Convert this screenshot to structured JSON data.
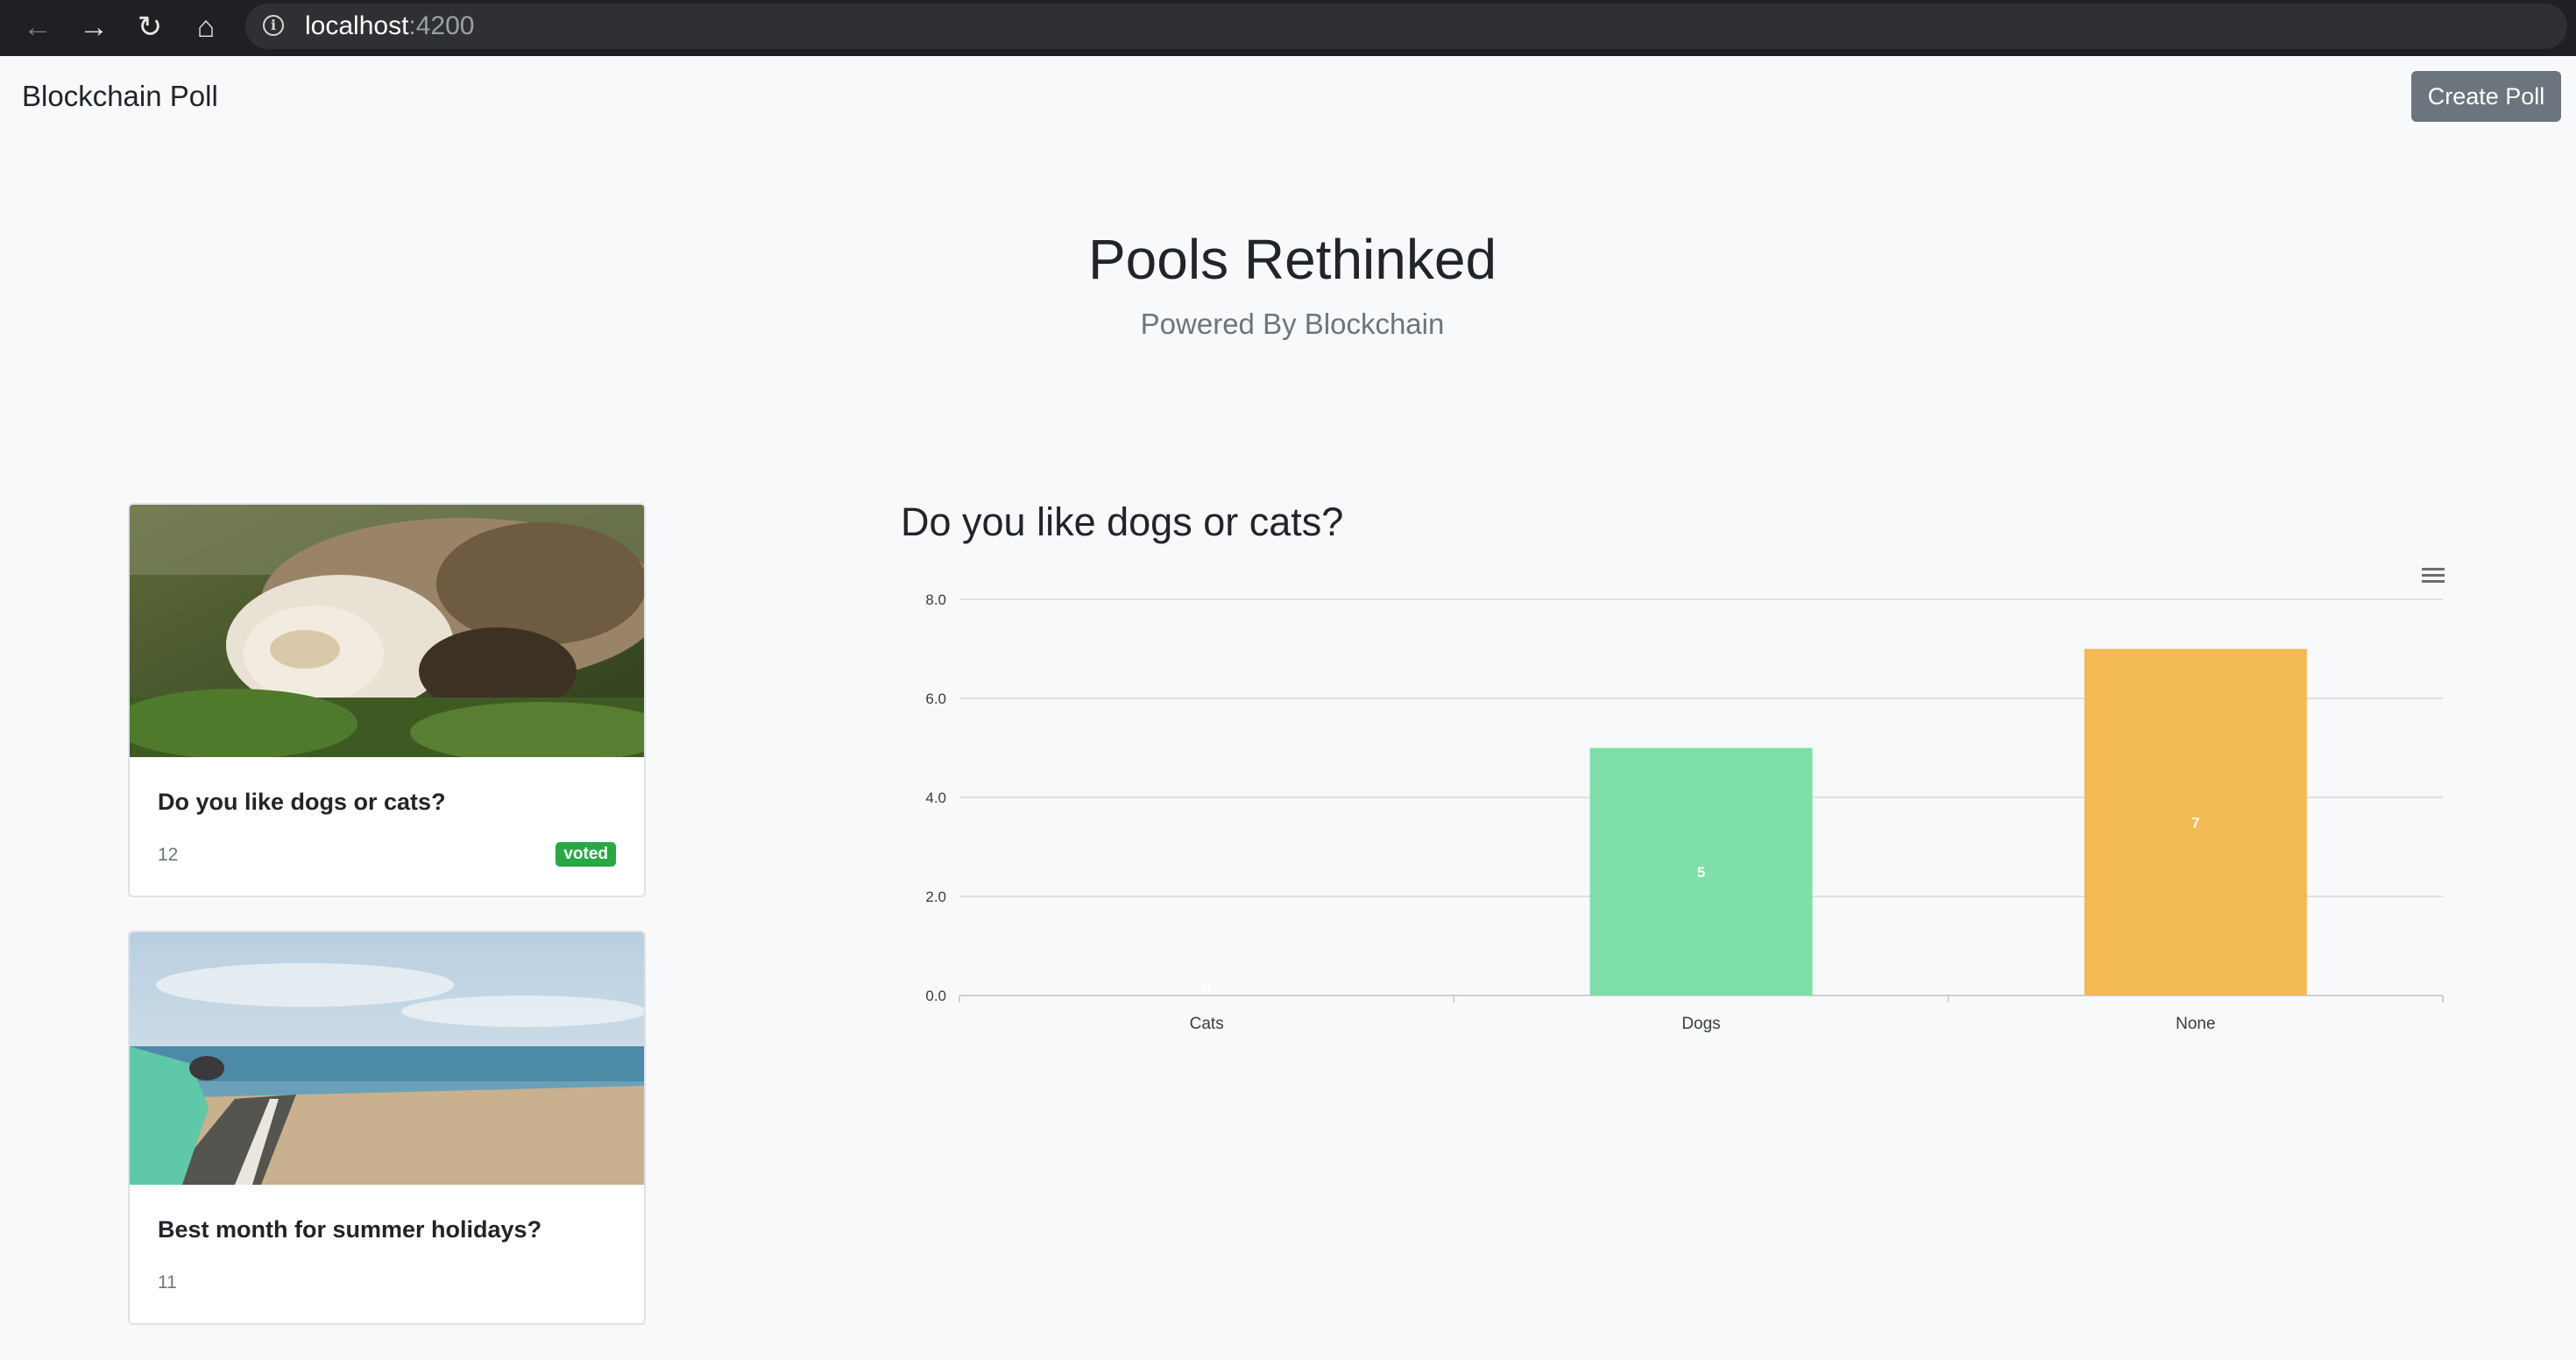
{
  "browser": {
    "url_host": "localhost",
    "url_port": ":4200"
  },
  "navbar": {
    "brand": "Blockchain Poll",
    "create_button": "Create Poll"
  },
  "hero": {
    "title": "Pools Rethinked",
    "subtitle": "Powered By Blockchain"
  },
  "polls": [
    {
      "title": "Do you like dogs or cats?",
      "count": "12",
      "badge": "voted"
    },
    {
      "title": "Best month for summer holidays?",
      "count": "11"
    }
  ],
  "chart_title": "Do you like dogs or cats?",
  "colors": {
    "dogs_bar": "#7ee0a8",
    "none_bar": "#f2b955",
    "badge": "#28a745",
    "button": "#6c757d"
  },
  "chart_data": {
    "type": "bar",
    "categories": [
      "Cats",
      "Dogs",
      "None"
    ],
    "values": [
      0,
      5,
      7
    ],
    "data_labels": [
      "0",
      "5",
      "7"
    ],
    "yticks": [
      "0.0",
      "2.0",
      "4.0",
      "6.0",
      "8.0"
    ],
    "ylim": [
      0,
      8
    ],
    "grid": true,
    "colors": [
      "#7ee0a8",
      "#7ee0a8",
      "#f2b955"
    ]
  }
}
